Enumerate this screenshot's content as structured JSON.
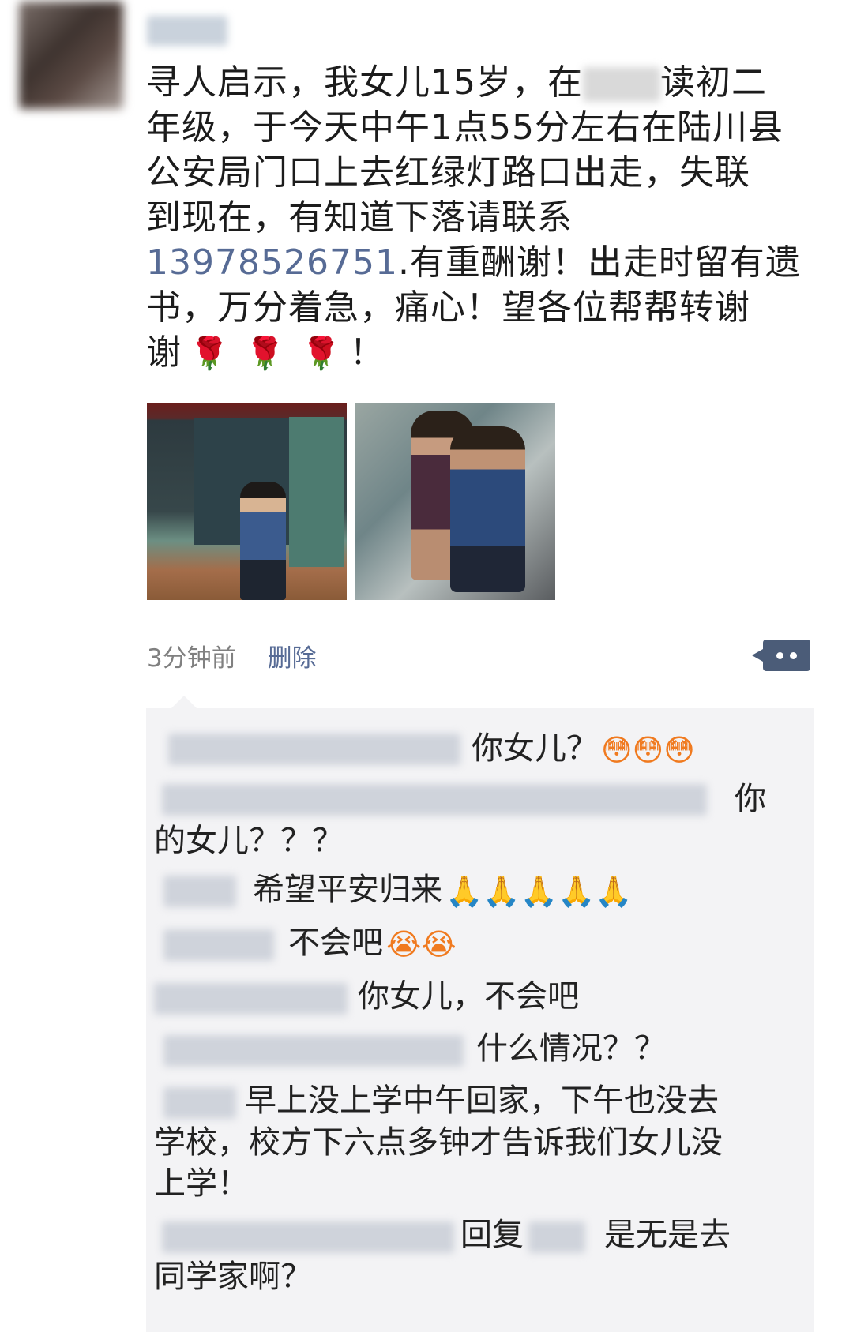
{
  "post": {
    "lines": [
      "寻人启示，我女儿15岁，在",
      "读初二",
      "年级，于今天中午1点55分左右在陆川县",
      "公安局门口上去红绿灯路口出走，失联",
      "到现在，有知道下落请联系",
      "13978526751",
      ".有重酬谢！出走时留有遗",
      "书，万分着急，痛心！望各位帮帮转谢",
      "谢",
      "！"
    ],
    "rose_emoji": "🌹",
    "link_color": "#576b95"
  },
  "meta": {
    "time": "3分钟前",
    "delete_label": "删除",
    "more_icon": "more-dots-icon"
  },
  "comments": [
    {
      "text": "你女儿？",
      "emoji": "😳😳😳"
    },
    {
      "text": "你",
      "cont": "的女儿？？？"
    },
    {
      "text": "希望平安归来",
      "emoji": "🙏🙏🙏🙏🙏"
    },
    {
      "text": "不会吧",
      "emoji": "😭😭"
    },
    {
      "text": "你女儿，不会吧"
    },
    {
      "text": "什么情况？？"
    },
    {
      "text": "早上没上学中午回家，下午也没去",
      "cont": "学校，校方下六点多钟才告诉我们女儿没",
      "cont2": "上学！"
    },
    {
      "reply": "回复",
      "text": "是无是去",
      "cont": "同学家啊？"
    }
  ]
}
